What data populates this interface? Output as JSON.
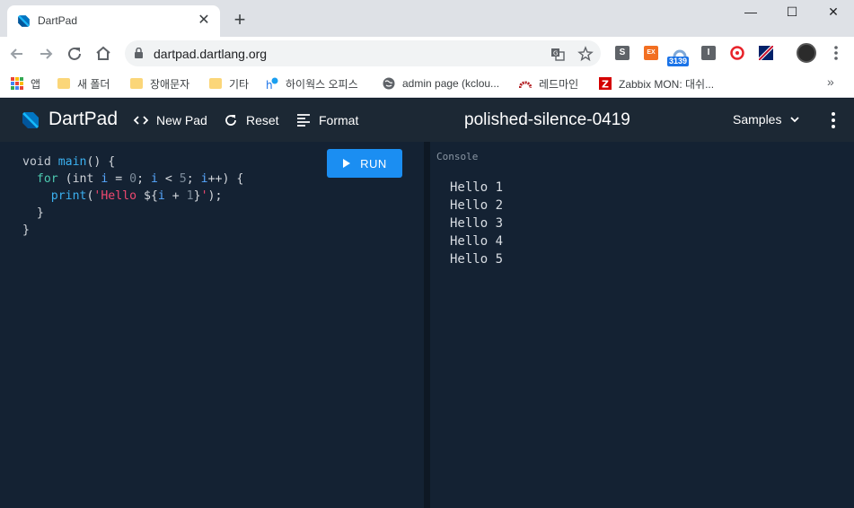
{
  "browser": {
    "tab_title": "DartPad",
    "tab_close": "✕",
    "new_tab": "+",
    "url": "dartpad.dartlang.org",
    "window_controls": {
      "minimize": "—",
      "maximize": "☐",
      "close": "✕"
    },
    "extensions": [
      {
        "name": "s-extension-icon",
        "label": "S",
        "color": "#5f6368"
      },
      {
        "name": "ex-extension-icon",
        "label": "EX",
        "color": "#f26f21"
      },
      {
        "name": "counter-extension-icon",
        "label": "",
        "color": "#7ea8d8"
      },
      {
        "name": "i-extension-icon",
        "label": "I",
        "color": "#5f6368"
      },
      {
        "name": "red-extension-icon",
        "label": "",
        "color": "#e8242b"
      },
      {
        "name": "flag-extension-icon",
        "label": "",
        "color": "#c8102e"
      }
    ],
    "extension_badge": "3139"
  },
  "bookmarks": [
    {
      "label": "앱",
      "icon": "apps-icon"
    },
    {
      "label": "새 폴더",
      "icon": "folder-icon"
    },
    {
      "label": "장애문자",
      "icon": "folder-icon"
    },
    {
      "label": "기타",
      "icon": "folder-icon"
    },
    {
      "label": "하이웍스 오피스",
      "icon": "hiworks-icon"
    },
    {
      "label": "admin page (kclou...",
      "icon": "globe-icon"
    },
    {
      "label": "레드마인",
      "icon": "redmine-icon"
    },
    {
      "label": "Zabbix MON: 대쉬...",
      "icon": "zabbix-icon"
    }
  ],
  "bookmarks_more": "»",
  "dartpad": {
    "brand": "DartPad",
    "new_pad": "New Pad",
    "reset": "Reset",
    "format": "Format",
    "title": "polished-silence-0419",
    "samples": "Samples",
    "run": "RUN",
    "console_label": "Console",
    "console_lines": [
      "Hello 1",
      "Hello 2",
      "Hello 3",
      "Hello 4",
      "Hello 5"
    ]
  },
  "code": {
    "l1_void": "void",
    "l1_main": "main",
    "l1_rest": "() {",
    "l2_for": "for",
    "l2_a": " (",
    "l2_int": "int",
    "l2_i1": "i",
    "l2_eq": " = ",
    "l2_0": "0",
    "l2_semi1": "; ",
    "l2_i2": "i",
    "l2_lt": " < ",
    "l2_5": "5",
    "l2_semi2": "; ",
    "l2_i3": "i",
    "l2_inc": "++) {",
    "l3_print": "print",
    "l3_open": "(",
    "l3_str1": "'Hello ",
    "l3_interp_open": "${",
    "l3_i": "i",
    "l3_plus": " + ",
    "l3_1": "1",
    "l3_interp_close": "}",
    "l3_str2": "'",
    "l3_close": ");",
    "l4": "}",
    "l5": "}"
  }
}
